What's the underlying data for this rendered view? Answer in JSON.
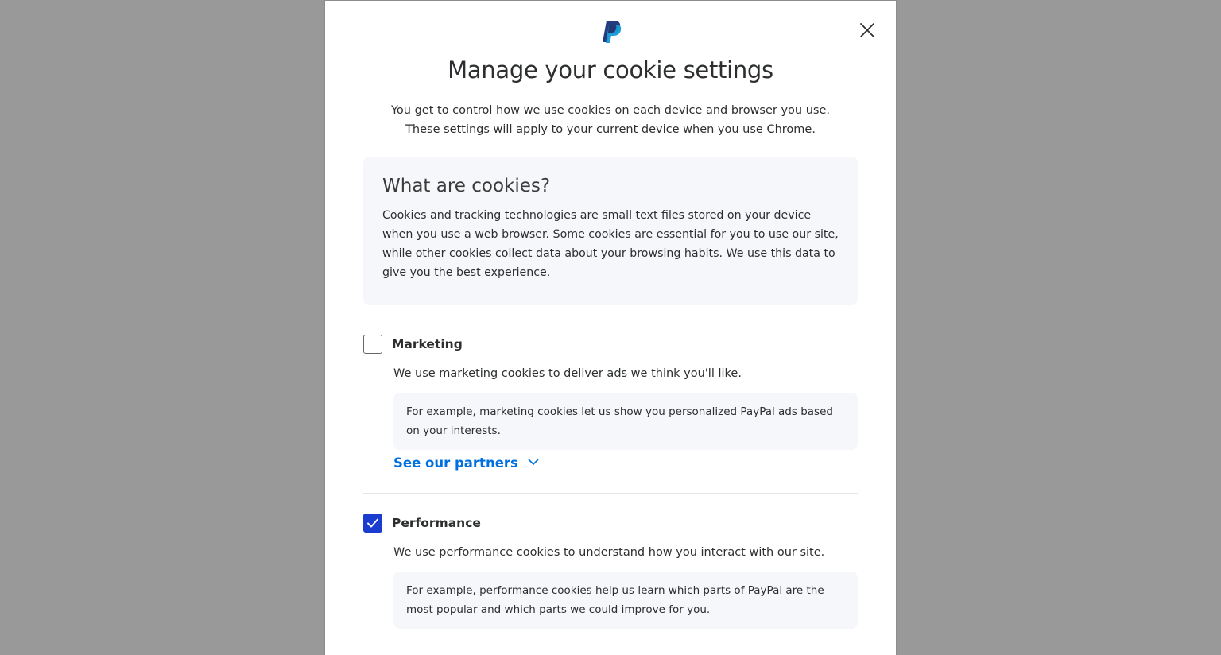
{
  "modal": {
    "logo_icon": "paypal-logo-icon",
    "close_icon": "close-icon",
    "title": "Manage your cookie settings",
    "intro": "You get to control how we use cookies on each device and browser you use. These settings will apply to your current device when you use Chrome."
  },
  "info": {
    "heading": "What are cookies?",
    "body": "Cookies and tracking technologies are small text files stored on your device when you use a web browser. Some cookies are essential for you to use our site, while other cookies collect data about your browsing habits. We use this data to give you the best experience."
  },
  "marketing": {
    "label": "Marketing",
    "checked": false,
    "description": "We use marketing cookies to deliver ads we think you'll like.",
    "example": "For example, marketing cookies let us show you personalized PayPal ads based on your interests.",
    "partners_link": "See our partners",
    "partners_icon": "chevron-down-icon"
  },
  "performance": {
    "label": "Performance",
    "checked": true,
    "description": "We use performance cookies to understand how you interact with our site.",
    "example": "For example, performance cookies help us learn which parts of PayPal are the most popular and which parts we could improve for you."
  },
  "colors": {
    "overlay": "#999999",
    "accent": "#1a3ccf",
    "link": "#0070e0",
    "panel": "#f5f7fa"
  }
}
